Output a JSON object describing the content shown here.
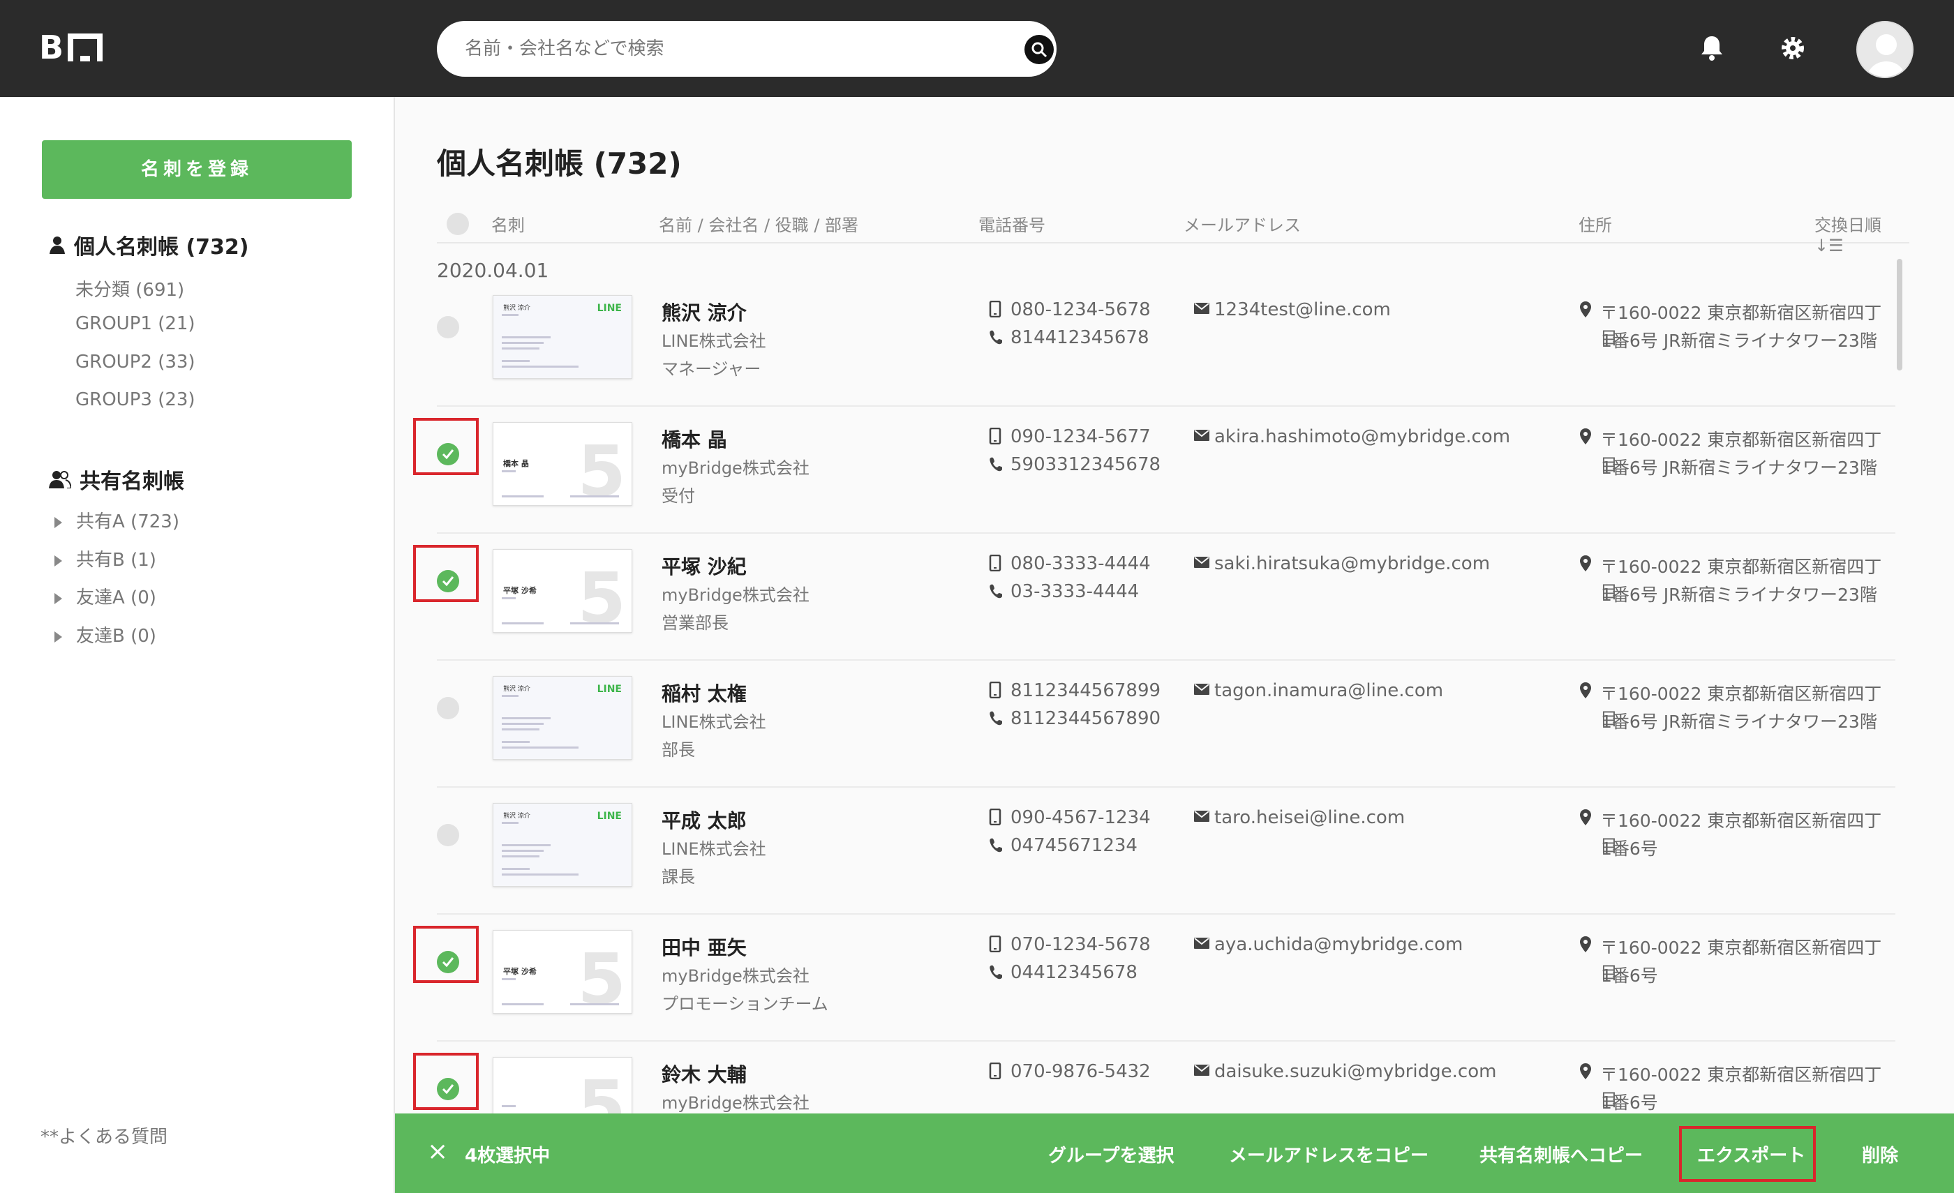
{
  "header": {
    "logo_text": "B",
    "search_placeholder": "名前・会社名などで検索"
  },
  "sidebar": {
    "register_label": "名刺を登録",
    "personal_title": "個人名刺帳 (732)",
    "personal_items": [
      "未分類 (691)",
      "GROUP1 (21)",
      "GROUP2 (33)",
      "GROUP3 (23)"
    ],
    "shared_title": "共有名刺帳",
    "shared_items": [
      "共有A (723)",
      "共有B (1)",
      "友達A (0)",
      "友達B (0)"
    ],
    "faq": "**よくある質問"
  },
  "main": {
    "title": "個人名刺帳 (732)",
    "columns": {
      "card": "名刺",
      "name": "名前 / 会社名 / 役職 / 部署",
      "phone": "電話番号",
      "email": "メールアドレス",
      "address": "住所",
      "sort": "交換日順↓☰"
    },
    "date_group": "2020.04.01",
    "rows": [
      {
        "name": "熊沢 涼介",
        "company": "LINE株式会社",
        "position": "マネージャー",
        "mobile": "080-1234-5678",
        "tel": "814412345678",
        "email": "1234test@line.com",
        "addr1": "〒160-0022 東京都新宿区新宿四丁目",
        "addr2": "1番6号 JR新宿ミライナタワー23階",
        "selected": false,
        "card": "line",
        "card_name": "熊沢 涼介",
        "card_logo": "LINE"
      },
      {
        "name": "橋本 晶",
        "company": "myBridge株式会社",
        "position": "受付",
        "mobile": "090-1234-5677",
        "tel": "5903312345678",
        "email": "akira.hashimoto@mybridge.com",
        "addr1": "〒160-0022 東京都新宿区新宿四丁目",
        "addr2": "1番6号 JR新宿ミライナタワー23階",
        "selected": true,
        "card": "mb",
        "card_name": "橋本 晶",
        "card_logo": ""
      },
      {
        "name": "平塚 沙紀",
        "company": "myBridge株式会社",
        "position": "営業部長",
        "mobile": "080-3333-4444",
        "tel": "03-3333-4444",
        "email": "saki.hiratsuka@mybridge.com",
        "addr1": "〒160-0022 東京都新宿区新宿四丁目",
        "addr2": "1番6号 JR新宿ミライナタワー23階",
        "selected": true,
        "card": "mb",
        "card_name": "平塚 沙希",
        "card_logo": ""
      },
      {
        "name": "稲村 太権",
        "company": "LINE株式会社",
        "position": "部長",
        "mobile": "8112344567899",
        "tel": "8112344567890",
        "email": "tagon.inamura@line.com",
        "addr1": "〒160-0022 東京都新宿区新宿四丁目",
        "addr2": "1番6号 JR新宿ミライナタワー23階",
        "selected": false,
        "card": "line",
        "card_name": "熊沢 涼介",
        "card_logo": "LINE"
      },
      {
        "name": "平成 太郎",
        "company": "LINE株式会社",
        "position": "課長",
        "mobile": "090-4567-1234",
        "tel": "04745671234",
        "email": "taro.heisei@line.com",
        "addr1": "〒160-0022 東京都新宿区新宿四丁目",
        "addr2": "1番6号",
        "selected": false,
        "card": "line",
        "card_name": "熊沢 涼介",
        "card_logo": "LINE"
      },
      {
        "name": "田中 亜矢",
        "company": "myBridge株式会社",
        "position": "プロモーションチーム",
        "mobile": "070-1234-5678",
        "tel": "04412345678",
        "email": "aya.uchida@mybridge.com",
        "addr1": "〒160-0022 東京都新宿区新宿四丁目",
        "addr2": "1番6号",
        "selected": true,
        "card": "mb",
        "card_name": "平塚 沙希",
        "card_logo": ""
      },
      {
        "name": "鈴木 大輔",
        "company": "myBridge株式会社",
        "position": "",
        "mobile": "070-9876-5432",
        "tel": "",
        "email": "daisuke.suzuki@mybridge.com",
        "addr1": "〒160-0022 東京都新宿区新宿四丁目",
        "addr2": "1番6号",
        "selected": true,
        "card": "mb",
        "card_name": "",
        "card_logo": ""
      }
    ]
  },
  "actionbar": {
    "close": "×",
    "count": "4枚選択中",
    "buttons": [
      "グループを選択",
      "メールアドレスをコピー",
      "共有名刺帳へコピー",
      "エクスポート",
      "削除"
    ]
  },
  "colors": {
    "accent": "#5cb85c",
    "header": "#2b2b2b",
    "highlight": "#d9262c"
  }
}
